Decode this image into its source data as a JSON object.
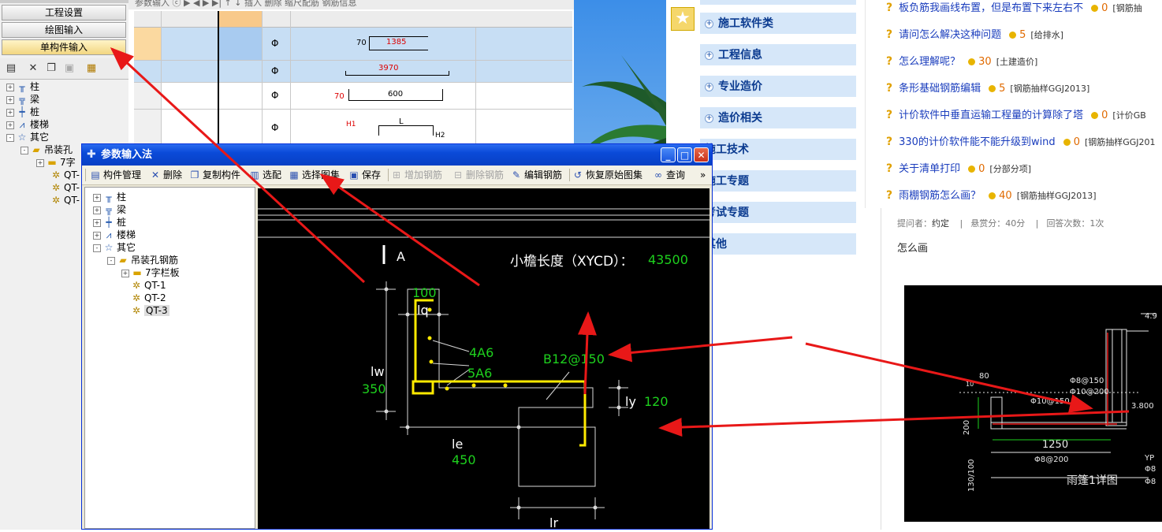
{
  "left_app": {
    "nav_buttons": [
      "工程设置",
      "绘图输入",
      "单构件输入"
    ],
    "tree": {
      "items": [
        {
          "label": "柱",
          "expander": "+"
        },
        {
          "label": "梁",
          "expander": "+"
        },
        {
          "label": "桩",
          "expander": "+"
        },
        {
          "label": "楼梯",
          "expander": "+"
        },
        {
          "label": "其它",
          "expander": "-"
        },
        {
          "label": "吊装孔",
          "expander": "-"
        },
        {
          "label": "7字",
          "expander": "+"
        },
        {
          "label": "QT-"
        },
        {
          "label": "QT-"
        },
        {
          "label": "QT-"
        }
      ]
    },
    "grid_toolbar_text": "参数输入 ⓒ     ▶  ◀  ▶  ▶|     ↑  ↓   插入  删除   缩尺配筋   钢筋信息",
    "grid_rows": [
      {
        "symbol": "Φ",
        "left_num": "70",
        "shape_num": "1385"
      },
      {
        "symbol": "Φ",
        "shape_num": "3970"
      },
      {
        "symbol": "Φ",
        "left_num": "70",
        "shape_num": "600"
      },
      {
        "symbol": "Φ",
        "labels": [
          "H1",
          "L",
          "H2"
        ]
      }
    ]
  },
  "dialog": {
    "title": "参数输入法",
    "toolbar": [
      {
        "label": "构件管理",
        "icon": "component-manage-icon",
        "enabled": true
      },
      {
        "label": "删除",
        "icon": "delete-icon",
        "enabled": true
      },
      {
        "label": "复制构件",
        "icon": "copy-icon",
        "enabled": true
      },
      {
        "label": "选配",
        "icon": "select-match-icon",
        "enabled": true
      },
      {
        "label": "选择图集",
        "icon": "select-atlas-icon",
        "enabled": true
      },
      {
        "label": "保存",
        "icon": "save-icon",
        "enabled": true
      },
      {
        "label": "增加钢筋",
        "icon": "add-rebar-icon",
        "enabled": false
      },
      {
        "label": "删除钢筋",
        "icon": "delete-rebar-icon",
        "enabled": false
      },
      {
        "label": "编辑钢筋",
        "icon": "edit-rebar-icon",
        "enabled": true
      },
      {
        "label": "恢复原始图集",
        "icon": "restore-atlas-icon",
        "enabled": true
      },
      {
        "label": "查询",
        "icon": "binoculars-icon",
        "enabled": true
      },
      {
        "label": "»",
        "icon": "more-icon",
        "enabled": true
      }
    ],
    "tree": [
      {
        "label": "柱",
        "expander": "+"
      },
      {
        "label": "梁",
        "expander": "+"
      },
      {
        "label": "桩",
        "expander": "+"
      },
      {
        "label": "楼梯",
        "expander": "+"
      },
      {
        "label": "其它",
        "expander": "-"
      },
      {
        "label": "吊装孔钢筋",
        "expander": "-"
      },
      {
        "label": "7字栏板",
        "expander": "+"
      },
      {
        "label": "QT-1"
      },
      {
        "label": "QT-2"
      },
      {
        "label": "QT-3",
        "selected": true
      }
    ],
    "drawing": {
      "section_mark": "A",
      "length_label": "小檐长度（XYCD）：",
      "length_value": "43500",
      "dim_top_value": "100",
      "dim_top_label": "lq",
      "rebar_1": "4A6",
      "rebar_2": "5A6",
      "rebar_main": "B12@150",
      "dim_left_label": "lw",
      "dim_left_value": "350",
      "dim_right_label": "ly",
      "dim_right_value": "120",
      "dim_bottom_label": "le",
      "dim_bottom_value": "450",
      "dim_lr_label": "lr"
    }
  },
  "web": {
    "menu": [
      "施工软件类",
      "工程信息",
      "专业造价",
      "造价相关",
      "施工技术",
      "施工专题",
      "考试专题",
      "其他"
    ],
    "menu_with_plus": [
      true,
      true,
      true,
      true,
      false,
      false,
      false,
      false
    ],
    "questions": [
      {
        "title": "板负筋我画线布置，但是布置下来左右不",
        "points": "0",
        "category": "[钢筋抽"
      },
      {
        "title": "请问怎么解决这种问题",
        "points": "5",
        "category": "[给排水]"
      },
      {
        "title": "怎么理解呢？",
        "points": "30",
        "category": "[土建造价]"
      },
      {
        "title": "条形基础钢筋编辑",
        "points": "5",
        "category": "[钢筋抽样GGJ2013]"
      },
      {
        "title": "计价软件中垂直运输工程量的计算除了塔",
        "points": "0",
        "category": "[计价GB"
      },
      {
        "title": "330的计价软件能不能升级到wind",
        "points": "0",
        "category": "[钢筋抽样GGJ201"
      },
      {
        "title": "关于清单打印",
        "points": "0",
        "category": "[分部分项]"
      },
      {
        "title": "雨棚钢筋怎么画？",
        "points": "40",
        "category": "[钢筋抽样GGJ2013]"
      }
    ],
    "asker_label": "提问者：",
    "asker": "约定",
    "reward": "悬赏分：40分",
    "answers": "回答次数：1次",
    "question_body": "怎么画",
    "cad": {
      "t1": "4.9",
      "t2": "80",
      "t3": "10",
      "t4": "Φ8@150",
      "t5": "Φ10@200",
      "t6": "Φ10@150",
      "t7": "3.800",
      "t8": "200",
      "t9": "1250",
      "t10": "Φ8@200",
      "t11": "130/100",
      "t12": "雨篷1详图",
      "t13": "YP",
      "t14": "Φ8",
      "t15": "Φ8"
    }
  },
  "colors": {
    "arrow": "#e81818",
    "cad_green": "#1ed01e",
    "rebar_yellow": "#ffea00",
    "menu_bg": "#d6e7f9"
  }
}
